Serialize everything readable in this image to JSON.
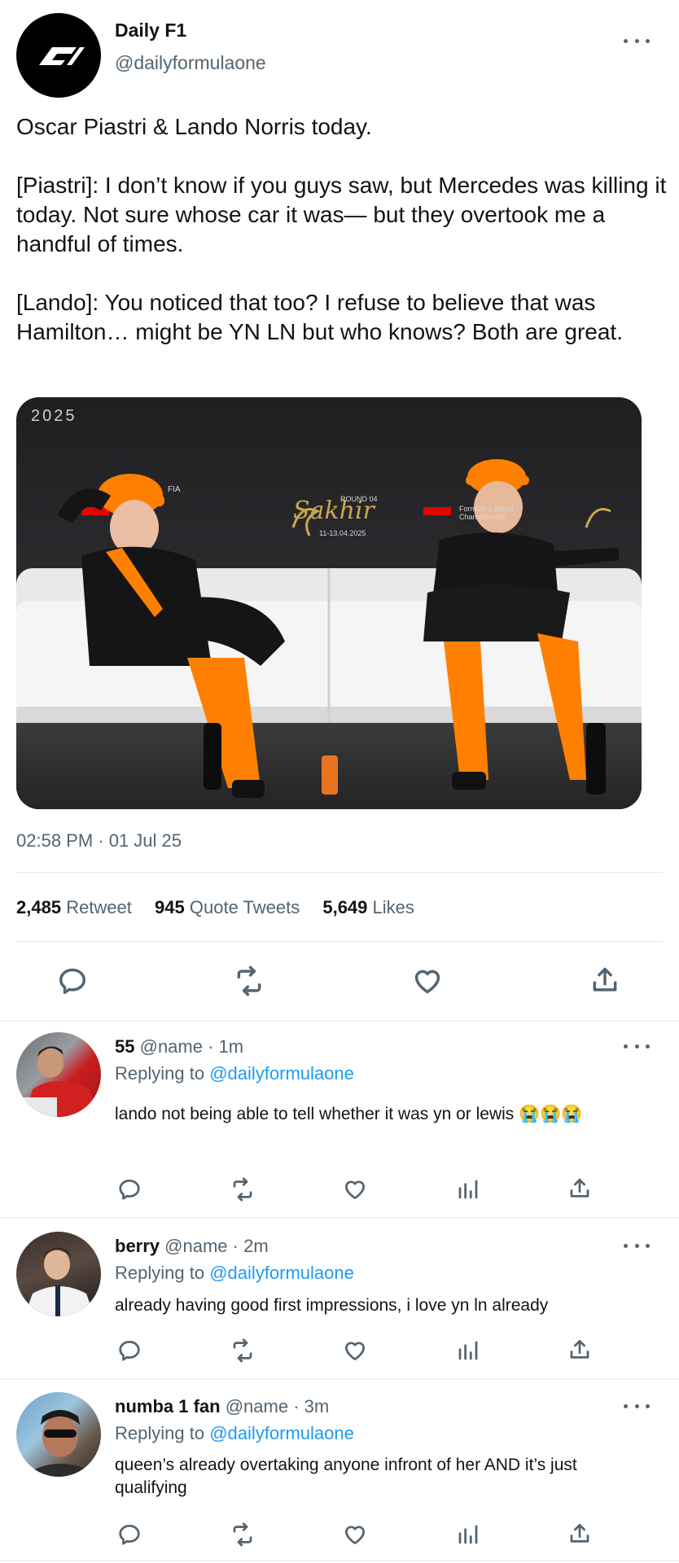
{
  "tweet": {
    "author_name": "Daily F1",
    "author_handle": "@dailyformulaone",
    "paragraphs": [
      "Oscar Piastri & Lando Norris today.",
      "[Piastri]: I don’t know if you guys saw, but Mercedes was killing it today. Not sure whose car it was— but they overtook me a handful of times.",
      "[Lando]: You noticed that too? I refuse to believe that was Hamilton… might be YN LN but who knows? Both are great."
    ],
    "image_text": {
      "year": "2025",
      "sakhir": "Sakhir",
      "round": "ROUND 04",
      "dates": "11-13.04.2025",
      "fia": "FIA",
      "championship": "Formula 1 World Championship"
    },
    "timestamp": "02:58 PM · 01 Jul 25",
    "stats": {
      "retweets_count": "2,485",
      "retweets_label": "Retweet",
      "quotes_count": "945",
      "quotes_label": "Quote Tweets",
      "likes_count": "5,649",
      "likes_label": "Likes"
    }
  },
  "replies": [
    {
      "name": "55",
      "handle": "@name",
      "time": "· 1m",
      "replying_prefix": "Replying to",
      "replying_handle": "@dailyformulaone",
      "text": "lando not being able to tell whether it was yn or lewis 😭😭😭"
    },
    {
      "name": "berry",
      "handle": "@name",
      "time": "· 2m",
      "replying_prefix": "Replying to",
      "replying_handle": "@dailyformulaone",
      "text": "already having good first impressions, i love yn ln already"
    },
    {
      "name": "numba 1 fan",
      "handle": "@name",
      "time": "· 3m",
      "replying_prefix": "Replying to",
      "replying_handle": "@dailyformulaone",
      "text": "queen’s already overtaking anyone infront of her AND it’s just qualifying"
    }
  ],
  "colors": {
    "accent": "#1d9bf0",
    "text": "#0f1419",
    "muted": "#536471",
    "papaya": "#ff8000"
  },
  "icons": [
    "f1-logo-icon",
    "more-icon",
    "reply-icon",
    "retweet-icon",
    "like-icon",
    "share-icon",
    "views-icon"
  ]
}
